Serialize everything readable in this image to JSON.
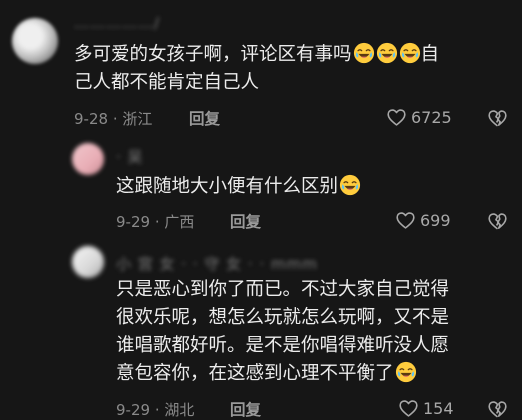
{
  "comments": [
    {
      "username": "……………/",
      "text_lines": [
        "多可爱的女孩子啊，评论区有事吗",
        "己人都不能肯定自己人"
      ],
      "line1_suffix": "自",
      "emoji_count": 3,
      "date": "9-28",
      "location": "浙江",
      "reply_label": "回复",
      "likes": "6725"
    },
    {
      "username": "· 吴",
      "text_lines": [
        "这跟随地大小便有什么区别"
      ],
      "date": "9-29",
      "location": "广西",
      "reply_label": "回复",
      "likes": "699"
    },
    {
      "username": "小 宫 女 · · 守 女 · · mmm",
      "text_lines": [
        "只是恶心到你了而已。不过大家自己觉得",
        "很欢乐呢，想怎么玩就怎么玩啊，又不是",
        "谁唱歌都好听。是不是你唱得难听没人愿",
        "意包容你，在这感到心理不平衡了"
      ],
      "date": "9-29",
      "location": "湖北",
      "reply_label": "回复",
      "likes": "154"
    }
  ],
  "icons": {
    "emoji": "crying-laughing-emoji-icon",
    "like": "heart-outline-icon",
    "dislike": "broken-heart-icon"
  },
  "colors": {
    "background": "#161616",
    "text": "#ececec",
    "meta": "#8a8a8a",
    "emoji_face": "#ffcc3d"
  }
}
